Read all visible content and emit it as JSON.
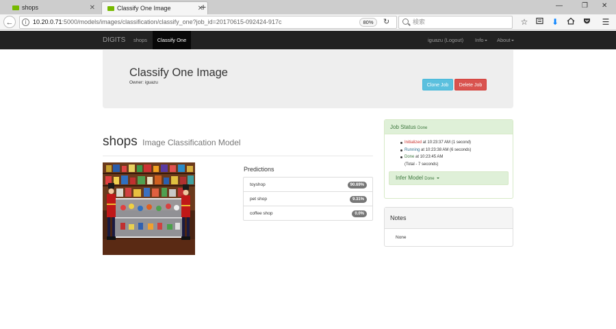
{
  "browser": {
    "tabs": [
      {
        "label": "shops",
        "active": false
      },
      {
        "label": "Classify One Image",
        "active": true
      }
    ],
    "url_host": "10.20.0.71",
    "url_rest": ":5000/models/images/classification/classify_one?job_id=20170615-092424-917c",
    "zoom": "80%",
    "search_placeholder": "検索"
  },
  "app_nav": {
    "brand": "DIGITS",
    "links": [
      "shops",
      "Classify One"
    ],
    "user": "iguazu (Logout)",
    "info": "Info",
    "about": "About"
  },
  "header": {
    "title": "Classify One Image",
    "owner": "Owner: iguazu",
    "clone_label": "Clone Job",
    "delete_label": "Delete Job"
  },
  "model": {
    "name": "shops",
    "subtitle": "Image Classification Model"
  },
  "predictions": {
    "title": "Predictions",
    "items": [
      {
        "label": "toyshop",
        "value": "90.69%"
      },
      {
        "label": "pet shop",
        "value": "9.31%"
      },
      {
        "label": "coffee shop",
        "value": "0.0%"
      }
    ]
  },
  "job_status": {
    "title": "Job Status",
    "state": "Done",
    "initialized": "Initialized",
    "initialized_text": " at 10:23:37 AM (1 second)",
    "running": "Running",
    "running_text": " at 10:23:38 AM (6 seconds)",
    "done": "Done",
    "done_text": " at 10:23:45 AM",
    "total": "(Total - 7 seconds)",
    "infer_label": "Infer Model",
    "infer_state": "Done"
  },
  "notes": {
    "title": "Notes",
    "body": "None"
  },
  "colors": {
    "navbar": "#222222",
    "clone": "#5bc0de",
    "delete": "#d9534f",
    "success_bg": "#dff0d8"
  }
}
